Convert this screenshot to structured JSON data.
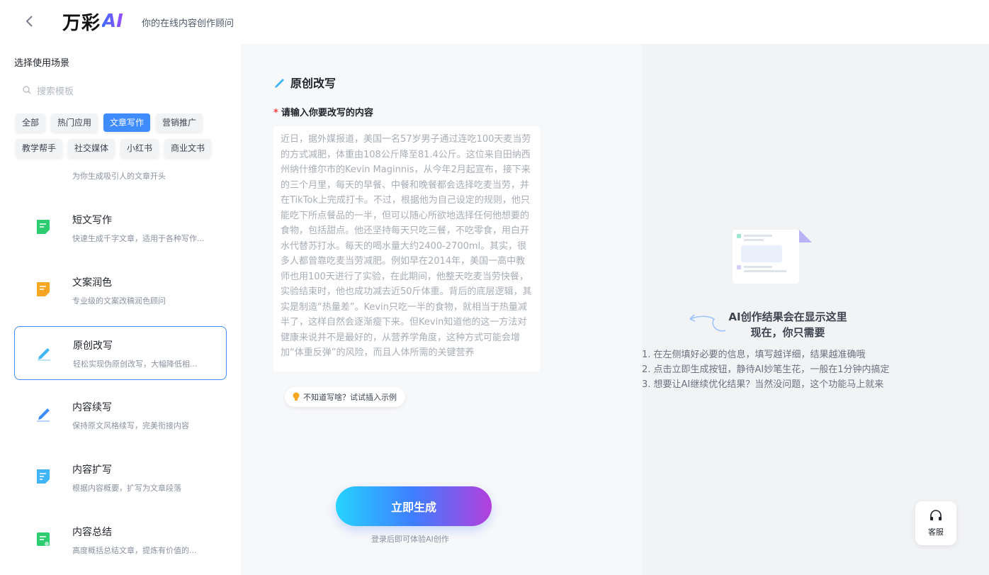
{
  "header": {
    "logo_text": "万彩",
    "logo_ai": "AI",
    "tagline": "你的在线内容创作顾问"
  },
  "sidebar": {
    "section_title": "选择使用场景",
    "search_placeholder": "搜索模板",
    "tags_row1": [
      "全部",
      "热门应用",
      "文章写作",
      "营销推广"
    ],
    "tags_row2": [
      "教学帮手",
      "社交媒体",
      "小红书",
      "商业文书"
    ],
    "active_tag": "文章写作",
    "tag_desc": "为你生成吸引人的文章开头",
    "scenes": [
      {
        "title": "短文写作",
        "desc": "快速生成千字文章，适用于各种写作...",
        "icon": "document-icon",
        "color": "#2ecc71"
      },
      {
        "title": "文案润色",
        "desc": "专业级的文案改稿润色顾问",
        "icon": "polish-icon",
        "color": "#f5a623"
      },
      {
        "title": "原创改写",
        "desc": "轻松实现伪原创改写，大幅降低相...",
        "icon": "pencil-icon",
        "color": "#3fb5f5"
      },
      {
        "title": "内容续写",
        "desc": "保持原文风格续写，完美衔接内容",
        "icon": "pen-icon",
        "color": "#3f8cff"
      },
      {
        "title": "内容扩写",
        "desc": "根据内容概要，扩写为文章段落",
        "icon": "expand-icon",
        "color": "#3fb5f5"
      },
      {
        "title": "内容总结",
        "desc": "高度概括总结文章，提炼有价值的...",
        "icon": "summary-icon",
        "color": "#2ecc71"
      }
    ]
  },
  "main": {
    "title": "原创改写",
    "field_label": "请输入你要改写的内容",
    "required_mark": "*",
    "input_text": "近日，据外媒报道，美国一名57岁男子通过连吃100天麦当劳的方式减肥，体重由108公斤降至81.4公斤。这位来自田纳西州纳什维尔市的Kevin Maginnis，从今年2月起宣布，接下来的三个月里，每天的早餐、中餐和晚餐都会选择吃麦当劳，并在TikTok上完成打卡。不过，根据他为自己设定的规则，他只能吃下所点餐品的一半，但可以随心所欲地选择任何他想要的食物，包括甜点。他还坚持每天只吃三餐，不吃零食，用白开水代替苏打水。每天的喝水量大约2400-2700ml。其实，很多人都曾靠吃麦当劳减肥。例如早在2014年，美国一高中教师也用100天进行了实验，在此期间，他整天吃麦当劳快餐，实验结束时，他也成功减去近50斤体重。背后的底层逻辑，其实是制造“热量差”。Kevin只吃一半的食物，就相当于热量减半了，这样自然会逐渐瘦下来。但Kevin知道他的这一方法对健康来说并不是最好的，从营养学角度，这种方式可能会增加“体重反弹”的风险，而且人体所需的关键营养",
    "hint_chip": "不知道写啥？试试插入示例",
    "generate_button": "立即生成",
    "login_note": "登录后即可体验AI创作"
  },
  "result": {
    "title_line1": "AI创作结果会在显示这里",
    "title_line2": "现在，你只需要",
    "steps": [
      "1. 在左侧填好必要的信息，填写越详细，结果越准确哦",
      "2. 点击立即生成按钮，静待AI妙笔生花，一般在1分钟内搞定",
      "3. 想要让AI继续优化结果？当然没问题，这个功能马上就来"
    ],
    "service_label": "客服"
  },
  "colors": {
    "accent": "#3f8cff",
    "required": "#f53f3f",
    "gradient_start": "#27d3ff",
    "gradient_end": "#b43fdc"
  }
}
